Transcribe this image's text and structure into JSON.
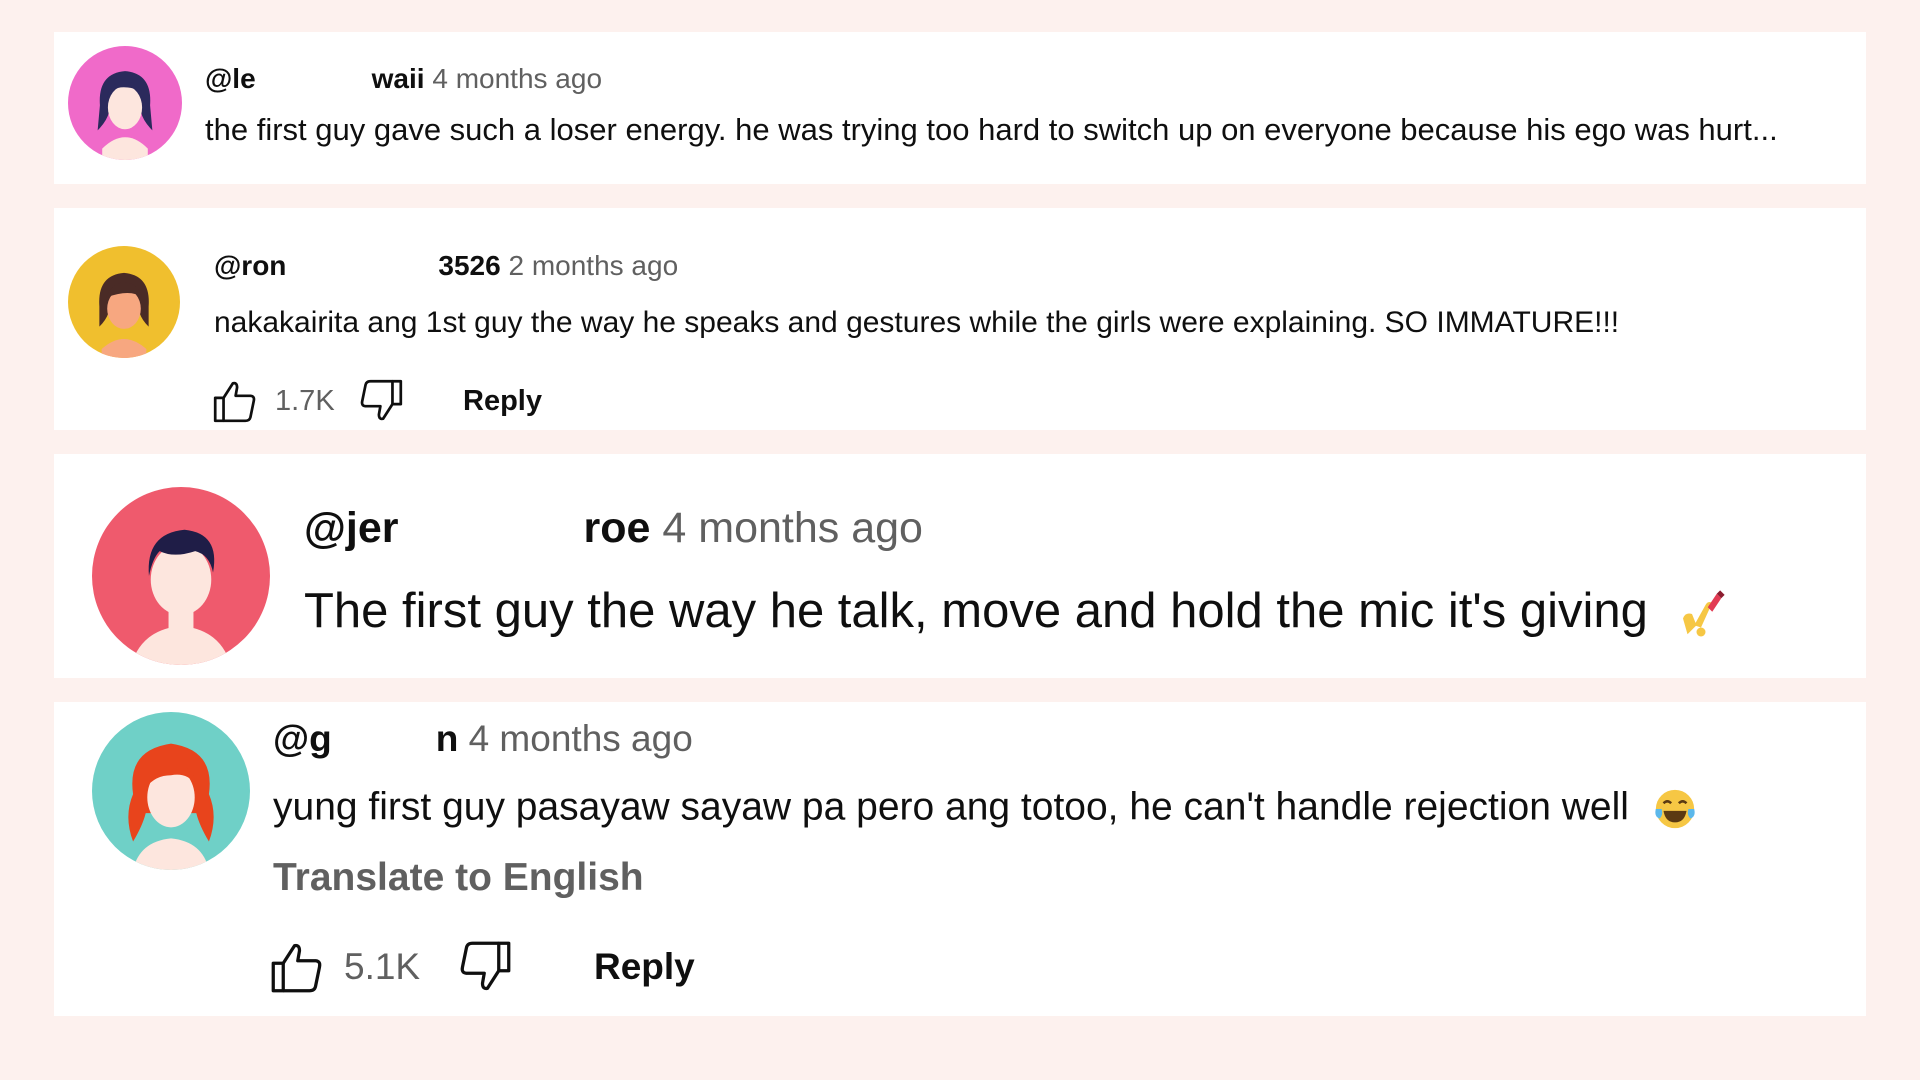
{
  "colors": {
    "background": "#fdf1ee",
    "card": "#ffffff",
    "muted_text": "#606060",
    "primary_text": "#0f0f0f"
  },
  "comments": [
    {
      "handle_start": "@le",
      "handle_end": "waii",
      "time": "4 months ago",
      "text": "the first guy gave such a loser energy. he was trying too hard to switch up on everyone because his ego was hurt...",
      "avatar_color": "#f06ac9",
      "avatar_icon": "woman-dark-hair-avatar"
    },
    {
      "handle_start": "@ron",
      "handle_end": "3526",
      "time": "2 months ago",
      "text": "nakakairita ang 1st guy the way he speaks and gestures while the girls were explaining. SO IMMATURE!!!",
      "avatar_color": "#f0bf2e",
      "avatar_icon": "woman-dark-hair-avatar",
      "likes": "1.7K",
      "reply_label": "Reply"
    },
    {
      "handle_start": "@jer",
      "handle_end": "roe",
      "time": "4 months ago",
      "text": "The first guy the way he talk, move and hold the mic it's giving",
      "emoji": "nail-polish-emoji",
      "avatar_color": "#ef5a6d",
      "avatar_icon": "person-dark-hair-avatar"
    },
    {
      "handle_start": "@g",
      "handle_end": "n",
      "time": "4 months ago",
      "text": "yung first guy pasayaw sayaw pa pero ang totoo, he can't handle rejection well",
      "emoji": "laughing-tears-emoji",
      "translate_label": "Translate to English",
      "avatar_color": "#6fd0c7",
      "avatar_icon": "woman-red-hair-avatar",
      "likes": "5.1K",
      "reply_label": "Reply"
    }
  ]
}
